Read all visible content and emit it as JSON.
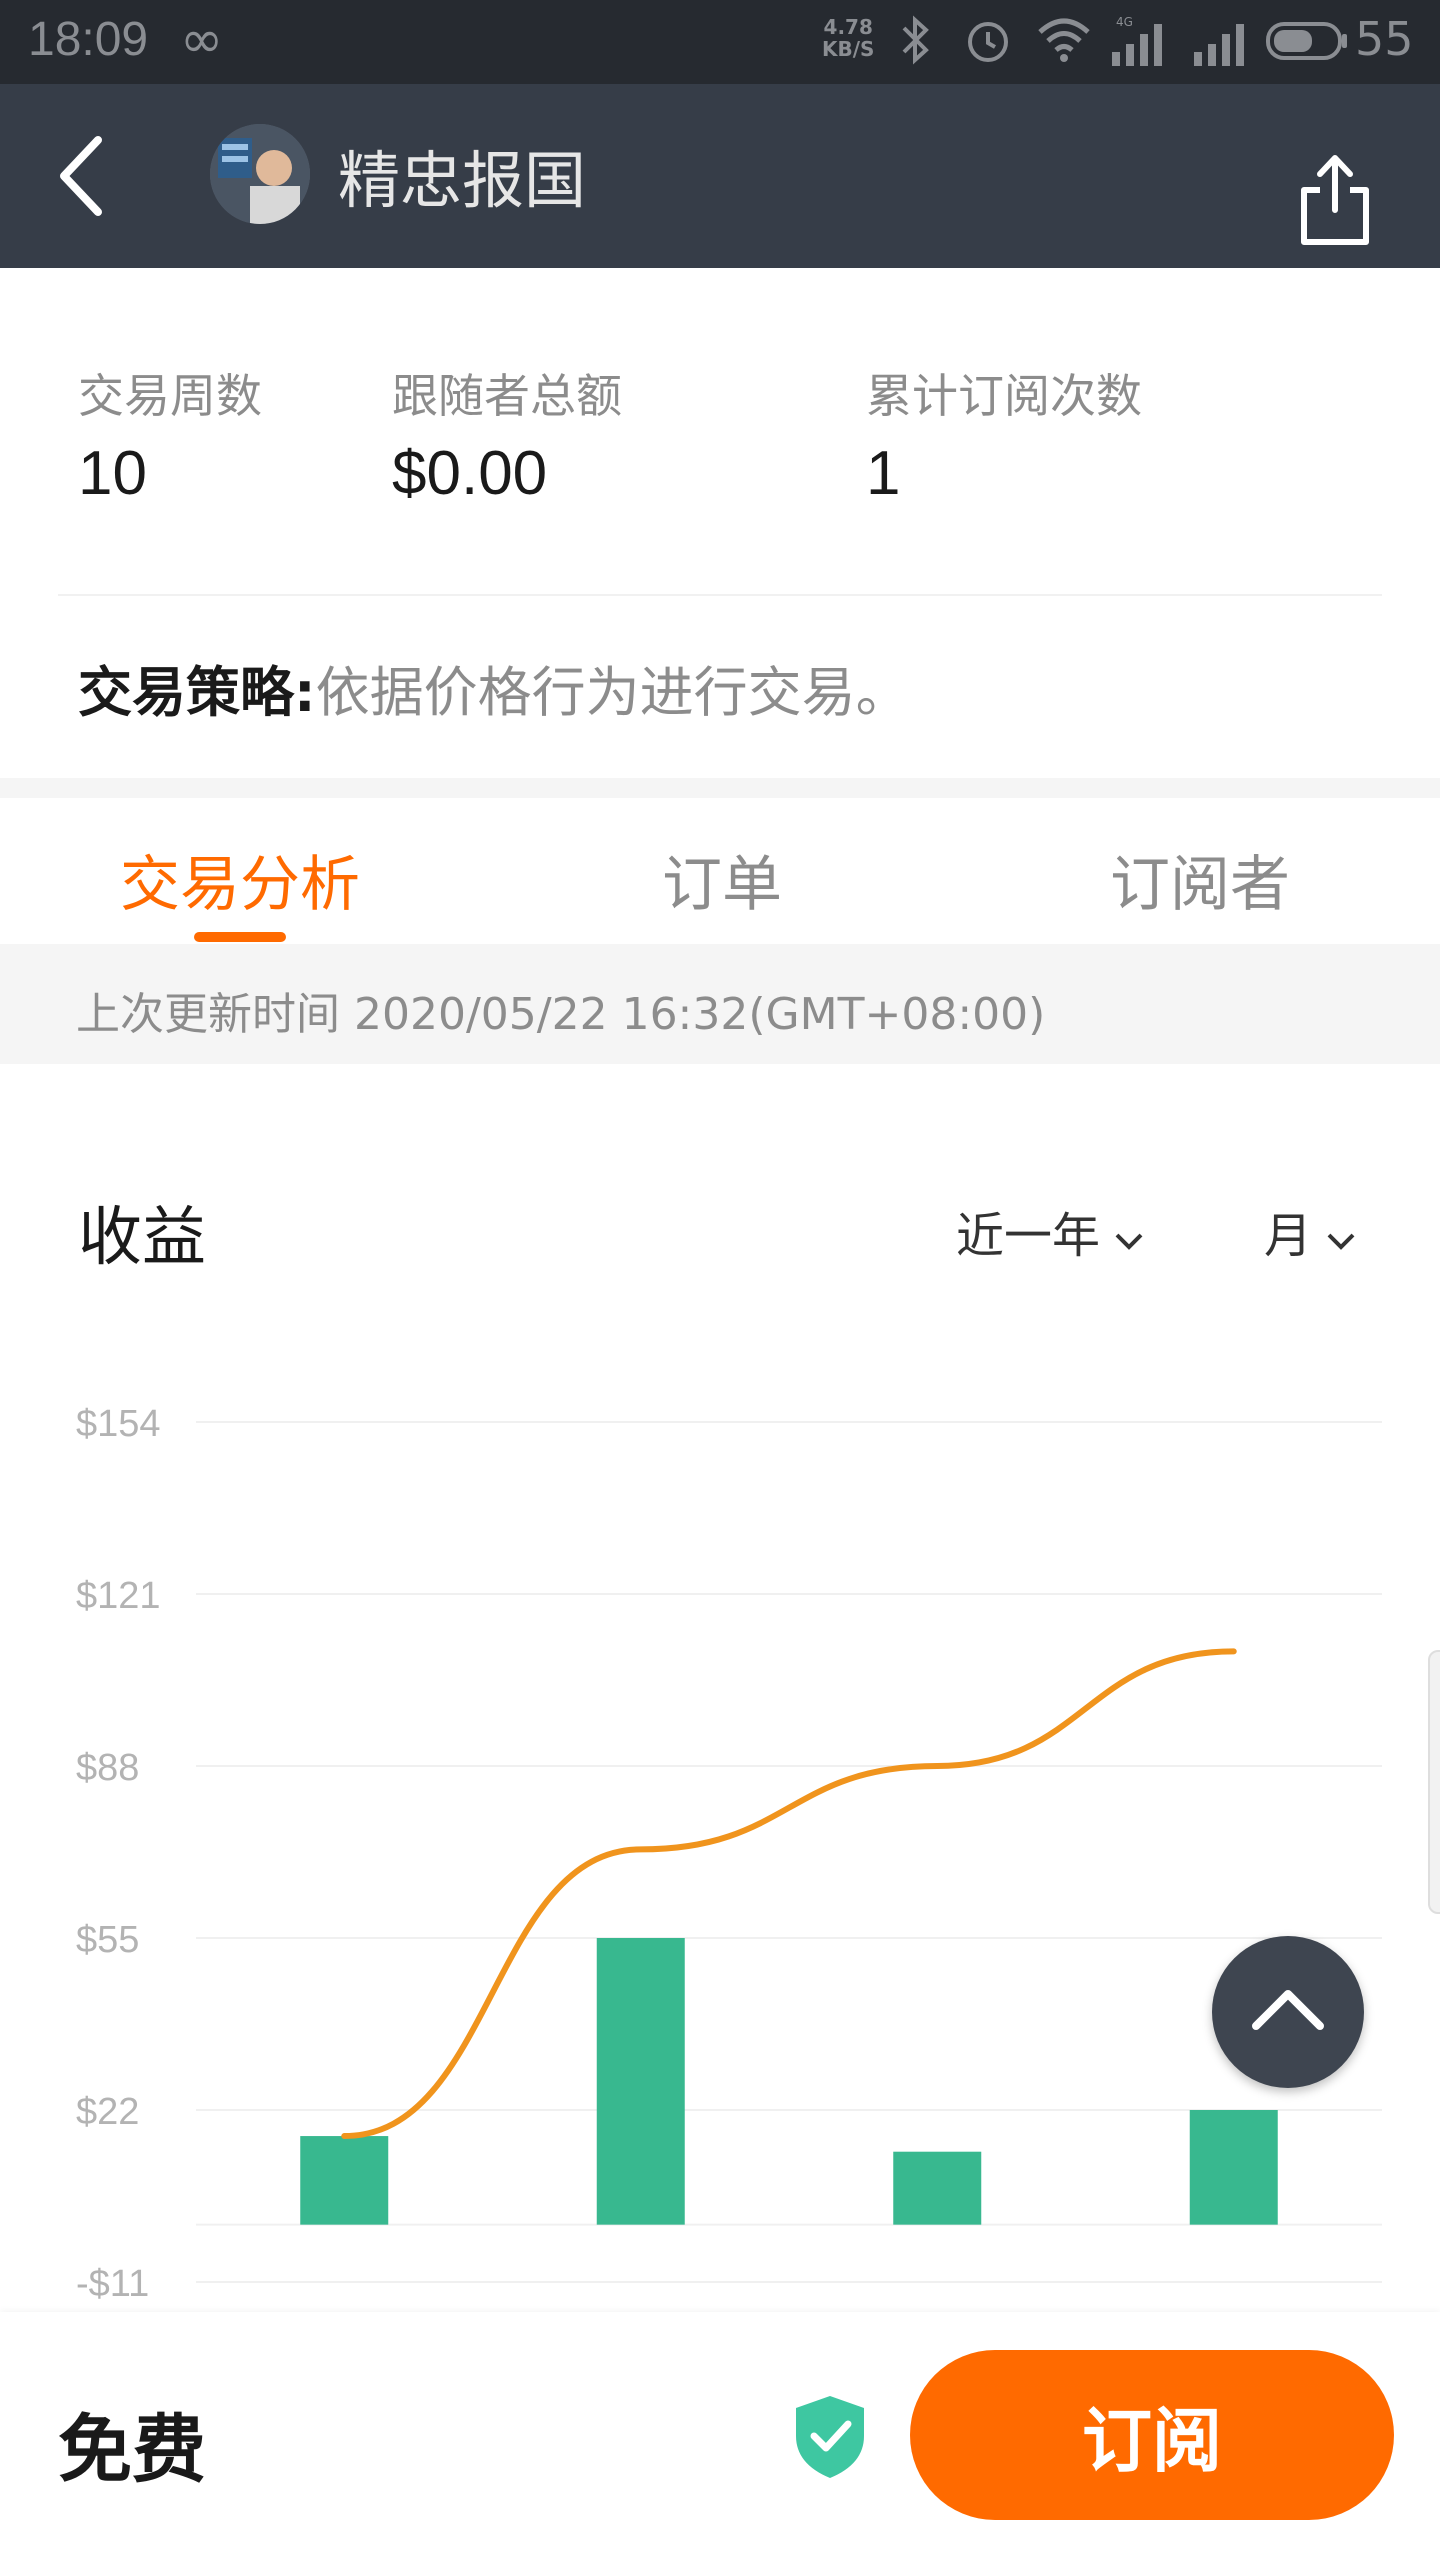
{
  "status_bar": {
    "time": "18:09",
    "network_speed_value": "4.78",
    "network_speed_unit": "KB/S",
    "battery": "55",
    "icons": [
      "infinity-icon",
      "bluetooth-icon",
      "alarm-icon",
      "wifi-icon",
      "signal-4g-icon",
      "signal-icon",
      "battery-icon"
    ]
  },
  "nav": {
    "back_icon": "chevron-left-icon",
    "title": "精忠报国",
    "share_icon": "share-icon"
  },
  "stats": [
    {
      "label": "交易周数",
      "value": "10"
    },
    {
      "label": "跟随者总额",
      "value": "$0.00"
    },
    {
      "label": "累计订阅次数",
      "value": "1"
    }
  ],
  "strategy": {
    "label": "交易策略:",
    "text": "依据价格行为进行交易。"
  },
  "tabs": [
    {
      "label": "交易分析",
      "active": true
    },
    {
      "label": "订单",
      "active": false
    },
    {
      "label": "订阅者",
      "active": false
    }
  ],
  "update_text": "上次更新时间 2020/05/22 16:32(GMT+08:00)",
  "earnings": {
    "title": "收益",
    "range_dropdown": "近一年",
    "period_dropdown": "月"
  },
  "chart_data": {
    "type": "bar",
    "y_ticks": [
      "$154",
      "$121",
      "$88",
      "$55",
      "$22",
      "-$11"
    ],
    "ylim": [
      -11,
      154
    ],
    "grid": true,
    "categories": [
      "",
      "",
      "",
      ""
    ],
    "series": [
      {
        "type": "bar",
        "values": [
          17,
          55,
          14,
          22
        ],
        "color": "#38b88f"
      },
      {
        "type": "line",
        "values": [
          17,
          72,
          88,
          110
        ],
        "color": "#f0941d"
      }
    ]
  },
  "bottom": {
    "price_label": "免费",
    "shield_icon": "shield-check-icon",
    "subscribe_label": "订阅"
  },
  "colors": {
    "accent": "#ff6a00",
    "nav_bg": "#363d48",
    "bar": "#38b88f",
    "line": "#f0941d"
  }
}
